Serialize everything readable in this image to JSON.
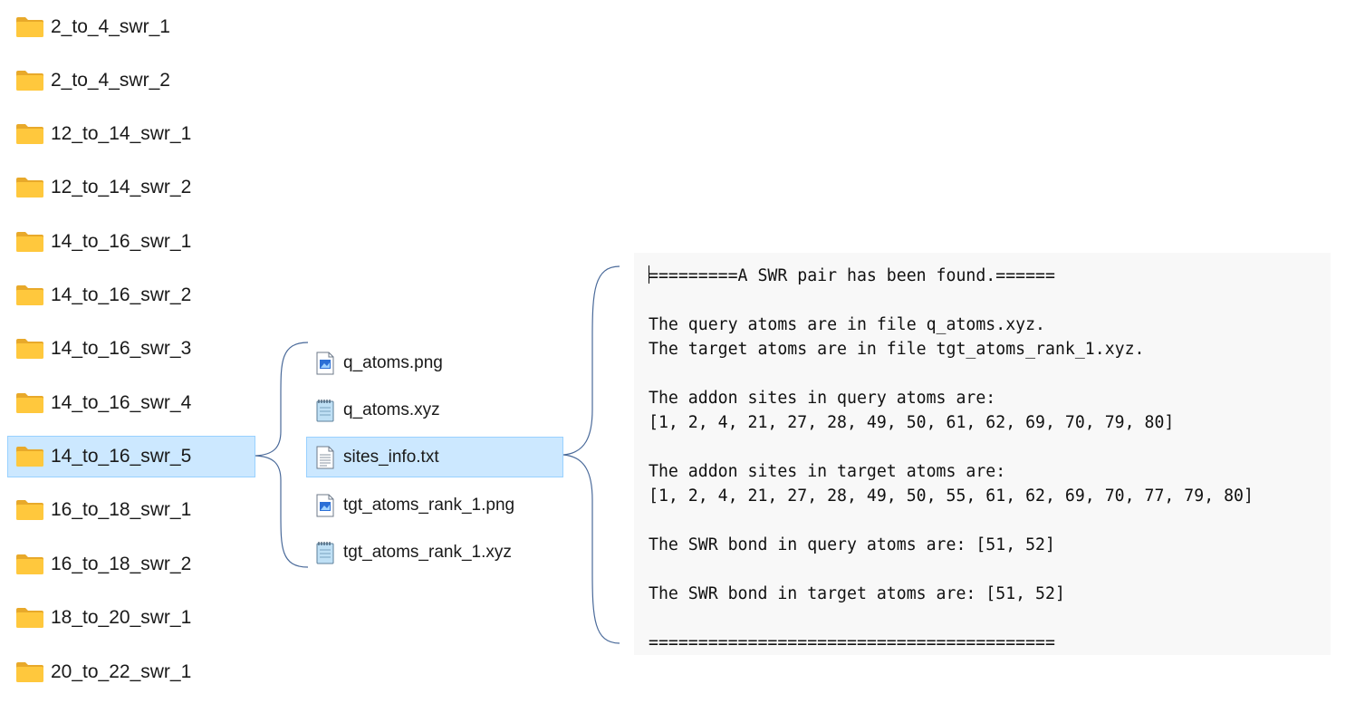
{
  "folders": [
    {
      "name": "2_to_4_swr_1",
      "selected": false
    },
    {
      "name": "2_to_4_swr_2",
      "selected": false
    },
    {
      "name": "12_to_14_swr_1",
      "selected": false
    },
    {
      "name": "12_to_14_swr_2",
      "selected": false
    },
    {
      "name": "14_to_16_swr_1",
      "selected": false
    },
    {
      "name": "14_to_16_swr_2",
      "selected": false
    },
    {
      "name": "14_to_16_swr_3",
      "selected": false
    },
    {
      "name": "14_to_16_swr_4",
      "selected": false
    },
    {
      "name": "14_to_16_swr_5",
      "selected": true
    },
    {
      "name": "16_to_18_swr_1",
      "selected": false
    },
    {
      "name": "16_to_18_swr_2",
      "selected": false
    },
    {
      "name": "18_to_20_swr_1",
      "selected": false
    },
    {
      "name": "20_to_22_swr_1",
      "selected": false
    }
  ],
  "files": [
    {
      "name": "q_atoms.png",
      "icon": "image-file-icon",
      "selected": false
    },
    {
      "name": "q_atoms.xyz",
      "icon": "notepad-file-icon",
      "selected": false
    },
    {
      "name": "sites_info.txt",
      "icon": "text-file-icon",
      "selected": true
    },
    {
      "name": "tgt_atoms_rank_1.png",
      "icon": "image-file-icon",
      "selected": false
    },
    {
      "name": "tgt_atoms_rank_1.xyz",
      "icon": "notepad-file-icon",
      "selected": false
    }
  ],
  "document": {
    "lines": [
      "=========A SWR pair has been found.======",
      "",
      "The query atoms are in file q_atoms.xyz.",
      "The target atoms are in file tgt_atoms_rank_1.xyz.",
      "",
      "The addon sites in query atoms are:",
      "[1, 2, 4, 21, 27, 28, 49, 50, 61, 62, 69, 70, 79, 80]",
      "",
      "The addon sites in target atoms are:",
      "[1, 2, 4, 21, 27, 28, 49, 50, 55, 61, 62, 69, 70, 77, 79, 80]",
      "",
      "The SWR bond in query atoms are: [51, 52]",
      "",
      "The SWR bond in target atoms are: [51, 52]",
      "",
      "========================================="
    ]
  },
  "colors": {
    "selection_bg": "#cce8ff",
    "selection_border": "#99d1ff",
    "folder_yellow": "#ffc83d",
    "bracket_stroke": "#4a6a9a",
    "doc_bg": "#f8f8f8"
  }
}
